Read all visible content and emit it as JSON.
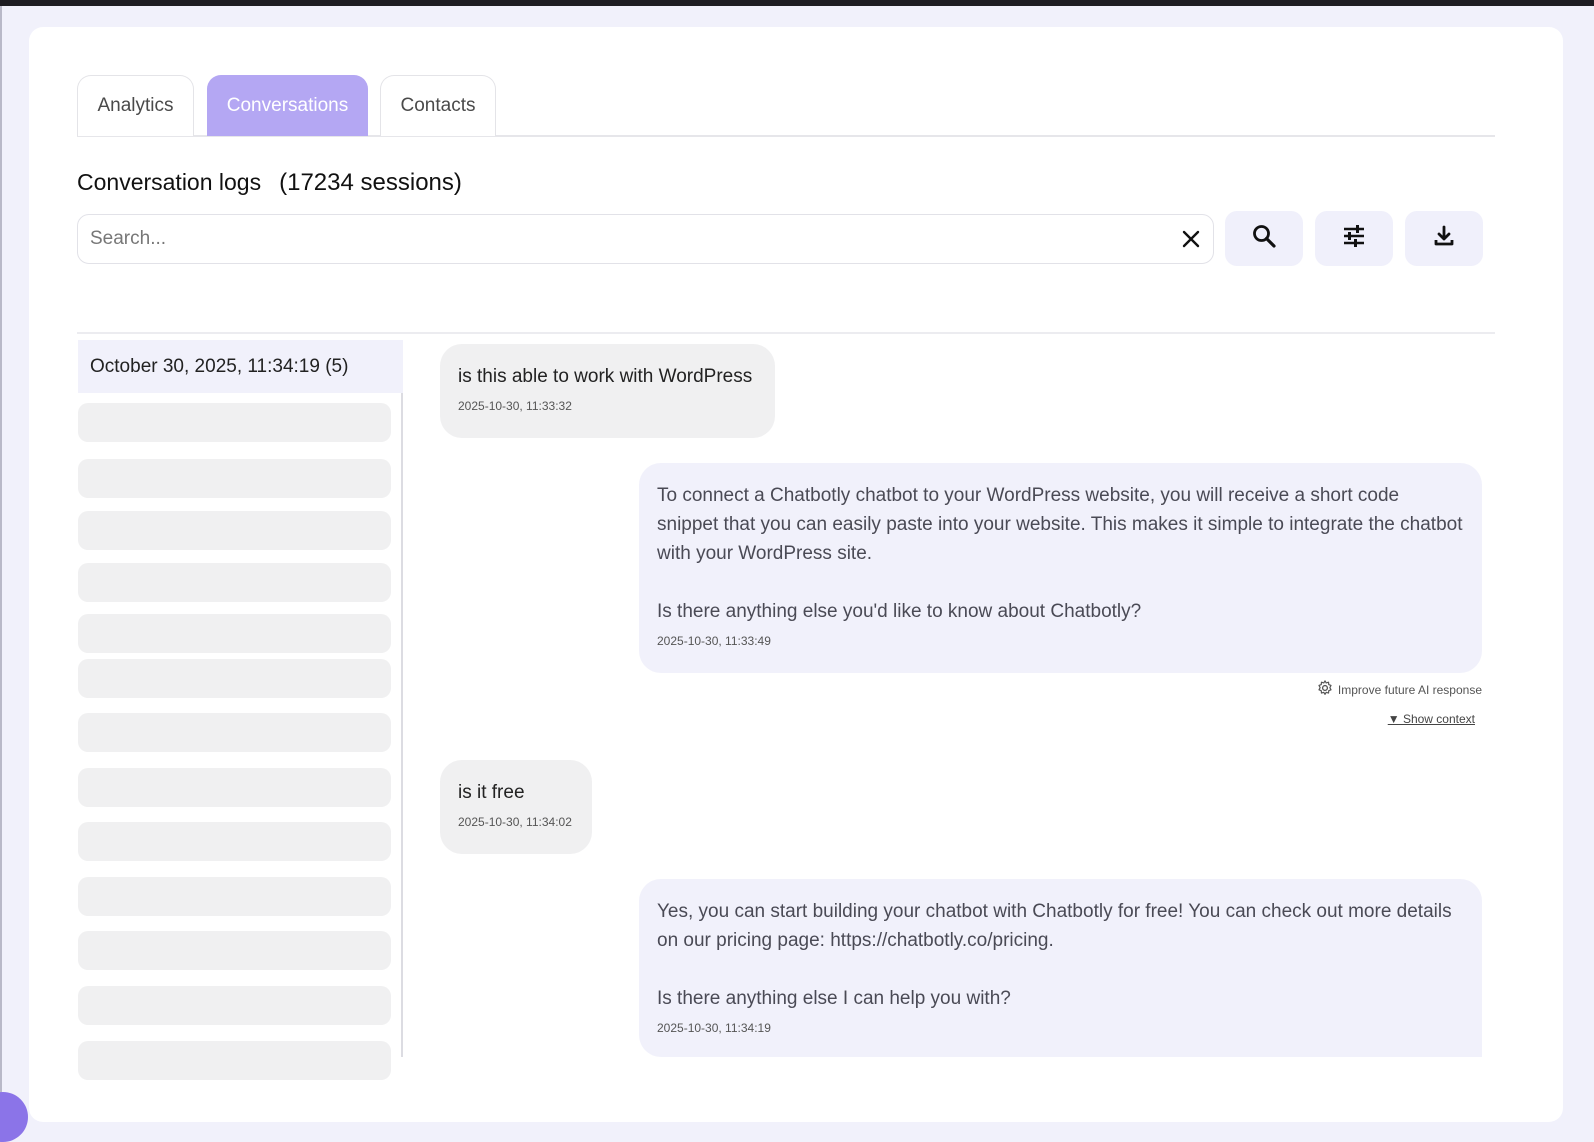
{
  "tabs": [
    {
      "label": "Analytics",
      "active": false
    },
    {
      "label": "Conversations",
      "active": true
    },
    {
      "label": "Contacts",
      "active": false
    }
  ],
  "header": {
    "title": "Conversation logs",
    "count": "(17234 sessions)"
  },
  "search": {
    "placeholder": "Search...",
    "value": ""
  },
  "toolbar": {
    "clear_icon": "close-icon",
    "search_icon": "search-icon",
    "filter_icon": "sliders-icon",
    "download_icon": "download-icon"
  },
  "sessions": {
    "selected": "October 30, 2025, 11:34:19 (5)",
    "placeholder_count": 13
  },
  "messages": [
    {
      "role": "user",
      "text": "is this able to work with WordPress",
      "time": "2025-10-30, 11:33:32"
    },
    {
      "role": "bot",
      "text": "To connect a Chatbotly chatbot to your WordPress website, you will receive a short code snippet that you can easily paste into your website. This makes it simple to integrate the chatbot with your WordPress site.\n\nIs there anything else you'd like to know about Chatbotly?",
      "time": "2025-10-30, 11:33:49"
    },
    {
      "role": "user",
      "text": "is it free",
      "time": "2025-10-30, 11:34:02"
    },
    {
      "role": "bot",
      "text": "Yes, you can start building your chatbot with Chatbotly for free! You can check out more details on our pricing page: https://chatbotly.co/pricing.\n\nIs there anything else I can help you with?",
      "time": "2025-10-30, 11:34:19"
    }
  ],
  "actions": {
    "improve": "Improve future AI response",
    "show_context": "▼ Show context"
  },
  "colors": {
    "accent": "#b4a7f3",
    "bot_bubble": "#f1f1fb",
    "user_bubble": "#f0f0f1",
    "fab": "#8b74e8"
  }
}
